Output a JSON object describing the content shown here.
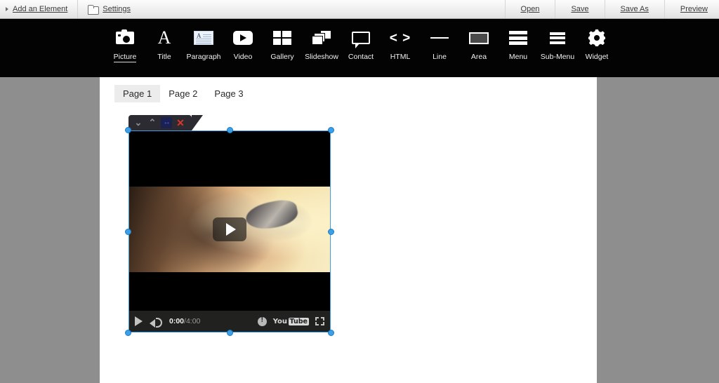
{
  "topbar": {
    "left_items": [
      {
        "label": "Add an Element",
        "icon": "arrow-bullet-icon"
      },
      {
        "label": "Settings",
        "icon": "folder-icon"
      }
    ],
    "right_items": [
      {
        "label": "Open"
      },
      {
        "label": "Save"
      },
      {
        "label": "Save As"
      },
      {
        "label": "Preview"
      }
    ]
  },
  "element_toolbar": {
    "items": [
      {
        "label": "Picture",
        "icon": "camera-icon",
        "active": true
      },
      {
        "label": "Title",
        "icon": "letter-a-icon",
        "active": false
      },
      {
        "label": "Paragraph",
        "icon": "text-lines-icon",
        "active": false
      },
      {
        "label": "Video",
        "icon": "play-icon",
        "active": false
      },
      {
        "label": "Gallery",
        "icon": "grid-icon",
        "active": false
      },
      {
        "label": "Slideshow",
        "icon": "stacked-cards-icon",
        "active": false
      },
      {
        "label": "Contact",
        "icon": "speech-bubble-icon",
        "active": false
      },
      {
        "label": "HTML",
        "icon": "code-brackets-icon",
        "active": false
      },
      {
        "label": "Line",
        "icon": "horizontal-line-icon",
        "active": false
      },
      {
        "label": "Area",
        "icon": "rectangle-icon",
        "active": false
      },
      {
        "label": "Menu",
        "icon": "hamburger-icon",
        "active": false
      },
      {
        "label": "Sub-Menu",
        "icon": "hamburger-small-icon",
        "active": false
      },
      {
        "label": "Widget",
        "icon": "gear-icon",
        "active": false
      }
    ]
  },
  "canvas": {
    "page_tabs": [
      {
        "label": "Page 1",
        "selected": true
      },
      {
        "label": "Page 2",
        "selected": false
      },
      {
        "label": "Page 3",
        "selected": false
      }
    ],
    "selected_element": {
      "type": "video",
      "element_toolbar_buttons": [
        {
          "name": "move-down",
          "glyph": "⌄"
        },
        {
          "name": "move-up",
          "glyph": "⌃"
        },
        {
          "name": "resize",
          "glyph": "↔"
        },
        {
          "name": "delete",
          "glyph": "✕"
        }
      ],
      "player": {
        "current_time": "0:00",
        "separator": "/",
        "duration": "4:00",
        "brand_you": "You",
        "brand_tube": "Tube",
        "info_glyph": "!"
      }
    }
  },
  "colors": {
    "toolbar_background": "#030303",
    "canvas_background": "#8e8e8e",
    "sheet_background": "#ffffff",
    "selection_handle": "#3c9fe8",
    "selection_border": "#3ba0e8",
    "delete_red": "#e0342c",
    "resize_blue": "#5a6fe8",
    "active_tab_background": "#ececec"
  }
}
